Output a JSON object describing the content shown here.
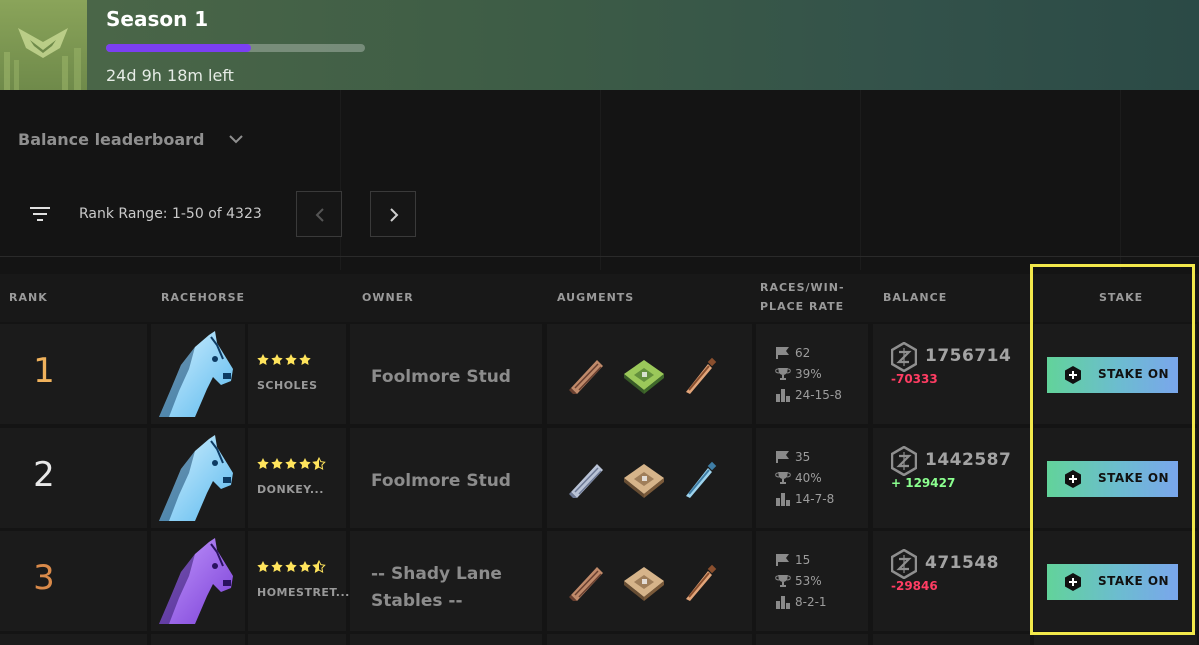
{
  "season": {
    "title": "Season 1",
    "progress": 0.56,
    "time_left": "24d 9h 18m left",
    "accent_color": "#7b3ff2"
  },
  "leaderboard": {
    "title": "Balance leaderboard",
    "rank_range": "Rank Range: 1-50 of 4323"
  },
  "table": {
    "headers": {
      "rank": "RANK",
      "racehorse": "RACEHORSE",
      "owner": "OWNER",
      "augments": "AUGMENTS",
      "races_line1": "RACES/WIN-",
      "races_line2": "PLACE RATE",
      "balance": "BALANCE",
      "stake": "STAKE"
    },
    "rows": [
      {
        "rank": "1",
        "rank_color": "#f0b25c",
        "horse_color": "ice-blue",
        "stars": 4,
        "horse_name": "SCHOLES",
        "owner": "Foolmore Stud",
        "augments": [
          "cpu-blade",
          "chip-green",
          "syringe-bronze"
        ],
        "races": "62",
        "win_rate": "39%",
        "record": "24-15-8",
        "balance": "1756714",
        "delta": "-70333",
        "delta_type": "neg",
        "stake_label": "STAKE ON"
      },
      {
        "rank": "2",
        "rank_color": "#e8e8e8",
        "horse_color": "ice-blue",
        "stars": 4.5,
        "horse_name": "DONKEY...",
        "owner": "Foolmore Stud",
        "augments": [
          "cpu-blade-silver",
          "chip-bronze",
          "syringe-blue"
        ],
        "races": "35",
        "win_rate": "40%",
        "record": "14-7-8",
        "balance": "1442587",
        "delta": "+ 129427",
        "delta_type": "pos",
        "stake_label": "STAKE ON"
      },
      {
        "rank": "3",
        "rank_color": "#d98a4a",
        "horse_color": "purple",
        "stars": 4.5,
        "horse_name": "HOMESTRET...",
        "owner": "-- Shady Lane Stables --",
        "augments": [
          "cpu-blade",
          "chip-bronze",
          "syringe-bronze"
        ],
        "races": "15",
        "win_rate": "53%",
        "record": "8-2-1",
        "balance": "471548",
        "delta": "-29846",
        "delta_type": "neg",
        "stake_label": "STAKE ON"
      }
    ]
  }
}
